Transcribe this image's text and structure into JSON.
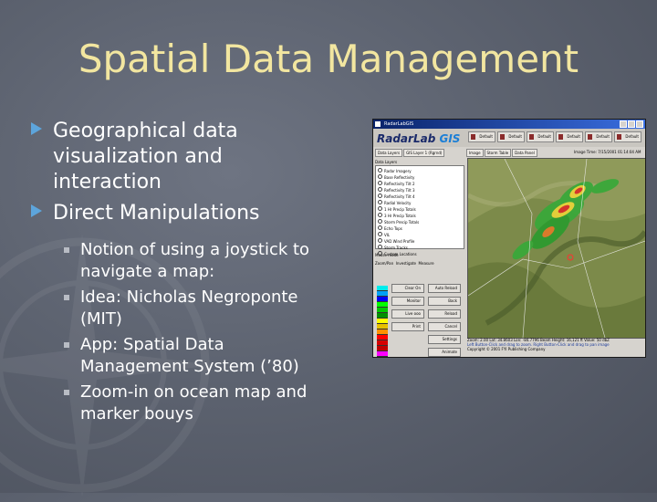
{
  "slide": {
    "title": "Spatial Data Management",
    "bullets": [
      {
        "text": "Geographical data visualization and interaction"
      },
      {
        "text": "Direct Manipulations"
      }
    ],
    "sub_bullets": [
      {
        "text": "Notion of using a joystick to navigate a map:"
      },
      {
        "text": "Idea: Nicholas Negroponte (MIT)"
      },
      {
        "text": "App: Spatial Data Management System (’80)"
      },
      {
        "text": "Zoom-in on ocean map and marker bouys"
      }
    ]
  },
  "app": {
    "window_title": "RadarLabGIS",
    "logo_main": "RadarLab",
    "logo_accent": "GIS",
    "default_buttons": [
      "Default",
      "Default",
      "Default",
      "Default",
      "Default",
      "Default"
    ],
    "left_tabs": [
      "Data Layers",
      "GIS Layer 1 (Rgrnd)"
    ],
    "data_layers_label": "Data Layers",
    "layers": [
      "Radar Imagery",
      "Base Reflectivity",
      "Reflectivity Tilt 2",
      "Reflectivity Tilt 3",
      "Reflectivity Tilt 4",
      "Radial Velocity",
      "1 Hr Precip Totals",
      "3 Hr Precip Totals",
      "Storm Precip Totals",
      "Echo Tops",
      "VIL",
      "VAD Wind Profile",
      "Storm Tracks",
      "Custom Locations"
    ],
    "mouse_mode_label": "Mouse mode",
    "mouse_modes": [
      "Zoom/Pan",
      "Investigate",
      "Measure"
    ],
    "panel_buttons": [
      "Clear On",
      "Auto Reload",
      "Monitor",
      "Back",
      "Live ooo",
      "Reload",
      "Print",
      "Cancel",
      "Settings",
      "Animate"
    ],
    "right_tabs": [
      "Image",
      "Storm Table",
      "Data Panel"
    ],
    "image_time": "Image Time: 7/15/2001 01:14:04 AM",
    "status_line1": "Zoom: 2.00   Lat: 34.8603   Lon: -84.7796   Beam Height: 16,121 ft   Value: 50 dbZ",
    "status_line2": "Left Button-Click and drag to zoom.  Right Button-Click and drag to pan image",
    "status_line3": "Copyright © 2001 FYI Publishing Company",
    "colors": {
      "titlebar": "#0a246a",
      "logo": "#1a2a6a",
      "logo_accent": "#1c7fd6",
      "slide_title": "#f2e6a0",
      "bullet_arrow": "#5da5dc"
    }
  }
}
